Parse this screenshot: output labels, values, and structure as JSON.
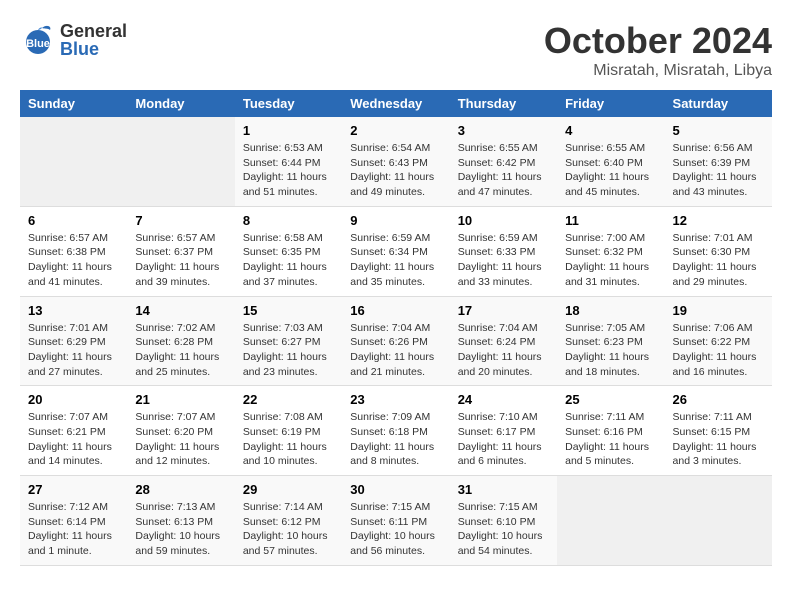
{
  "header": {
    "logo_general": "General",
    "logo_blue": "Blue",
    "month": "October 2024",
    "location": "Misratah, Misratah, Libya"
  },
  "days_of_week": [
    "Sunday",
    "Monday",
    "Tuesday",
    "Wednesday",
    "Thursday",
    "Friday",
    "Saturday"
  ],
  "weeks": [
    [
      {
        "day": null
      },
      {
        "day": null
      },
      {
        "day": 1,
        "sunrise": "6:53 AM",
        "sunset": "6:44 PM",
        "daylight": "11 hours and 51 minutes."
      },
      {
        "day": 2,
        "sunrise": "6:54 AM",
        "sunset": "6:43 PM",
        "daylight": "11 hours and 49 minutes."
      },
      {
        "day": 3,
        "sunrise": "6:55 AM",
        "sunset": "6:42 PM",
        "daylight": "11 hours and 47 minutes."
      },
      {
        "day": 4,
        "sunrise": "6:55 AM",
        "sunset": "6:40 PM",
        "daylight": "11 hours and 45 minutes."
      },
      {
        "day": 5,
        "sunrise": "6:56 AM",
        "sunset": "6:39 PM",
        "daylight": "11 hours and 43 minutes."
      }
    ],
    [
      {
        "day": 6,
        "sunrise": "6:57 AM",
        "sunset": "6:38 PM",
        "daylight": "11 hours and 41 minutes."
      },
      {
        "day": 7,
        "sunrise": "6:57 AM",
        "sunset": "6:37 PM",
        "daylight": "11 hours and 39 minutes."
      },
      {
        "day": 8,
        "sunrise": "6:58 AM",
        "sunset": "6:35 PM",
        "daylight": "11 hours and 37 minutes."
      },
      {
        "day": 9,
        "sunrise": "6:59 AM",
        "sunset": "6:34 PM",
        "daylight": "11 hours and 35 minutes."
      },
      {
        "day": 10,
        "sunrise": "6:59 AM",
        "sunset": "6:33 PM",
        "daylight": "11 hours and 33 minutes."
      },
      {
        "day": 11,
        "sunrise": "7:00 AM",
        "sunset": "6:32 PM",
        "daylight": "11 hours and 31 minutes."
      },
      {
        "day": 12,
        "sunrise": "7:01 AM",
        "sunset": "6:30 PM",
        "daylight": "11 hours and 29 minutes."
      }
    ],
    [
      {
        "day": 13,
        "sunrise": "7:01 AM",
        "sunset": "6:29 PM",
        "daylight": "11 hours and 27 minutes."
      },
      {
        "day": 14,
        "sunrise": "7:02 AM",
        "sunset": "6:28 PM",
        "daylight": "11 hours and 25 minutes."
      },
      {
        "day": 15,
        "sunrise": "7:03 AM",
        "sunset": "6:27 PM",
        "daylight": "11 hours and 23 minutes."
      },
      {
        "day": 16,
        "sunrise": "7:04 AM",
        "sunset": "6:26 PM",
        "daylight": "11 hours and 21 minutes."
      },
      {
        "day": 17,
        "sunrise": "7:04 AM",
        "sunset": "6:24 PM",
        "daylight": "11 hours and 20 minutes."
      },
      {
        "day": 18,
        "sunrise": "7:05 AM",
        "sunset": "6:23 PM",
        "daylight": "11 hours and 18 minutes."
      },
      {
        "day": 19,
        "sunrise": "7:06 AM",
        "sunset": "6:22 PM",
        "daylight": "11 hours and 16 minutes."
      }
    ],
    [
      {
        "day": 20,
        "sunrise": "7:07 AM",
        "sunset": "6:21 PM",
        "daylight": "11 hours and 14 minutes."
      },
      {
        "day": 21,
        "sunrise": "7:07 AM",
        "sunset": "6:20 PM",
        "daylight": "11 hours and 12 minutes."
      },
      {
        "day": 22,
        "sunrise": "7:08 AM",
        "sunset": "6:19 PM",
        "daylight": "11 hours and 10 minutes."
      },
      {
        "day": 23,
        "sunrise": "7:09 AM",
        "sunset": "6:18 PM",
        "daylight": "11 hours and 8 minutes."
      },
      {
        "day": 24,
        "sunrise": "7:10 AM",
        "sunset": "6:17 PM",
        "daylight": "11 hours and 6 minutes."
      },
      {
        "day": 25,
        "sunrise": "7:11 AM",
        "sunset": "6:16 PM",
        "daylight": "11 hours and 5 minutes."
      },
      {
        "day": 26,
        "sunrise": "7:11 AM",
        "sunset": "6:15 PM",
        "daylight": "11 hours and 3 minutes."
      }
    ],
    [
      {
        "day": 27,
        "sunrise": "7:12 AM",
        "sunset": "6:14 PM",
        "daylight": "11 hours and 1 minute."
      },
      {
        "day": 28,
        "sunrise": "7:13 AM",
        "sunset": "6:13 PM",
        "daylight": "10 hours and 59 minutes."
      },
      {
        "day": 29,
        "sunrise": "7:14 AM",
        "sunset": "6:12 PM",
        "daylight": "10 hours and 57 minutes."
      },
      {
        "day": 30,
        "sunrise": "7:15 AM",
        "sunset": "6:11 PM",
        "daylight": "10 hours and 56 minutes."
      },
      {
        "day": 31,
        "sunrise": "7:15 AM",
        "sunset": "6:10 PM",
        "daylight": "10 hours and 54 minutes."
      },
      {
        "day": null
      },
      {
        "day": null
      }
    ]
  ],
  "labels": {
    "sunrise_prefix": "Sunrise:",
    "sunset_prefix": "Sunset:",
    "daylight_prefix": "Daylight:"
  }
}
